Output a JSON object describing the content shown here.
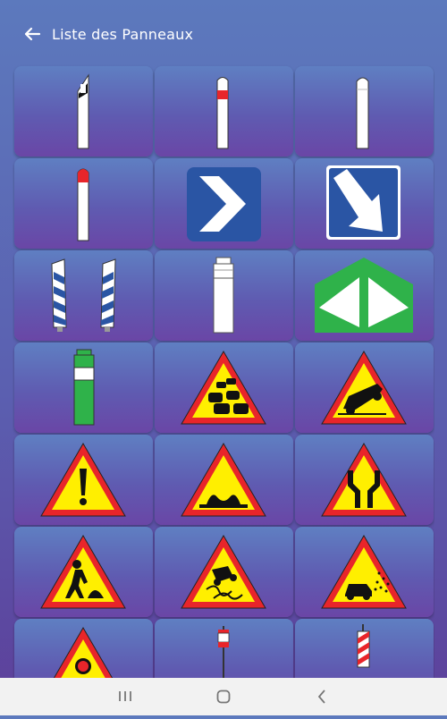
{
  "app_bar": {
    "back_icon": "arrow-left-icon",
    "title": "Liste des Panneaux"
  },
  "colors": {
    "bg_top": "#5c79bd",
    "bg_bottom": "#5d3f9a",
    "red": "#e8252a",
    "yellow": "#ffef00",
    "blue": "#2a55a4",
    "green": "#2fb24a"
  },
  "signs": [
    {
      "icon": "delineator-black-band-icon"
    },
    {
      "icon": "delineator-red-band-icon"
    },
    {
      "icon": "white-post-icon"
    },
    {
      "icon": "red-top-post-icon"
    },
    {
      "icon": "chevron-right-icon"
    },
    {
      "icon": "arrow-down-right-icon"
    },
    {
      "icon": "blue-striped-posts-icon"
    },
    {
      "icon": "white-beacon-icon"
    },
    {
      "icon": "green-diverge-icon"
    },
    {
      "icon": "green-beacon-icon"
    },
    {
      "icon": "temporary-traffic-jam-icon"
    },
    {
      "icon": "temporary-accident-icon"
    },
    {
      "icon": "temporary-danger-icon"
    },
    {
      "icon": "temporary-speed-bump-icon"
    },
    {
      "icon": "temporary-road-narrows-icon"
    },
    {
      "icon": "temporary-roadworks-icon"
    },
    {
      "icon": "temporary-slippery-road-icon"
    },
    {
      "icon": "temporary-gravel-icon"
    },
    {
      "icon": "temporary-traffic-light-icon"
    },
    {
      "icon": "red-white-post-icon"
    },
    {
      "icon": "striped-post-icon"
    }
  ],
  "system_nav": {
    "recent_icon": "recent-apps-icon",
    "home_icon": "home-icon",
    "back_icon": "nav-back-icon"
  }
}
